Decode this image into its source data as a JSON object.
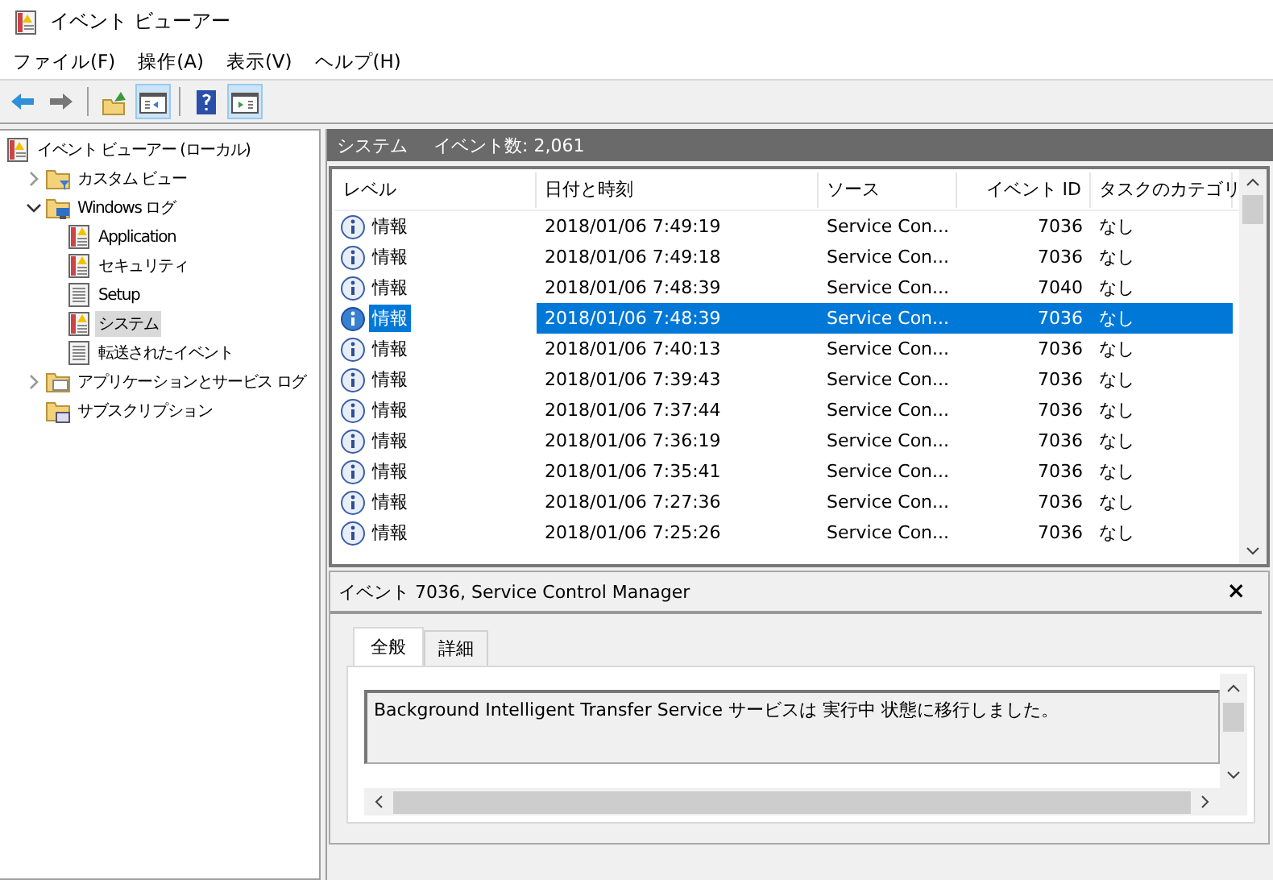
{
  "window": {
    "title": "イベント ビューアー"
  },
  "menu": [
    "ファイル(F)",
    "操作(A)",
    "表示(V)",
    "ヘルプ(H)"
  ],
  "toolbar": [
    {
      "kind": "back",
      "pressed": false
    },
    {
      "kind": "forward",
      "pressed": false
    },
    {
      "kind": "sep"
    },
    {
      "kind": "up",
      "pressed": false
    },
    {
      "kind": "tree-toggle",
      "pressed": true
    },
    {
      "kind": "sep"
    },
    {
      "kind": "help",
      "pressed": false
    },
    {
      "kind": "action-toggle",
      "pressed": true
    }
  ],
  "tree": [
    {
      "label": "イベント ビューアー (ローカル)",
      "kind": "viewer",
      "selected": false,
      "children": [
        {
          "label": "カスタム ビュー",
          "kind": "folder-filter",
          "expanded": false,
          "selected": false
        },
        {
          "label": "Windows ログ",
          "kind": "folder-computer",
          "expanded": true,
          "selected": false,
          "children": [
            {
              "label": "Application",
              "kind": "log-warn",
              "selected": false
            },
            {
              "label": "セキュリティ",
              "kind": "log-warn",
              "selected": false
            },
            {
              "label": "Setup",
              "kind": "log",
              "selected": false
            },
            {
              "label": "システム",
              "kind": "log-warn",
              "selected": true
            },
            {
              "label": "転送されたイベント",
              "kind": "log",
              "selected": false
            }
          ]
        },
        {
          "label": "アプリケーションとサービス ログ",
          "kind": "folder",
          "expanded": false,
          "selected": false
        },
        {
          "label": "サブスクリプション",
          "kind": "subscription",
          "selected": false
        }
      ]
    }
  ],
  "panel": {
    "title": "システム",
    "count": "イベント数: 2,061"
  },
  "table": {
    "columns": [
      "レベル",
      "日付と時刻",
      "ソース",
      "イベント ID",
      "タスクのカテゴリ"
    ],
    "rows": [
      {
        "level": "情報",
        "date": "2018/01/06 7:49:19",
        "source": "Service Con...",
        "id": "7036",
        "category": "なし",
        "selected": false
      },
      {
        "level": "情報",
        "date": "2018/01/06 7:49:18",
        "source": "Service Con...",
        "id": "7036",
        "category": "なし",
        "selected": false
      },
      {
        "level": "情報",
        "date": "2018/01/06 7:48:39",
        "source": "Service Con...",
        "id": "7040",
        "category": "なし",
        "selected": false
      },
      {
        "level": "情報",
        "date": "2018/01/06 7:48:39",
        "source": "Service Con...",
        "id": "7036",
        "category": "なし",
        "selected": true
      },
      {
        "level": "情報",
        "date": "2018/01/06 7:40:13",
        "source": "Service Con...",
        "id": "7036",
        "category": "なし",
        "selected": false
      },
      {
        "level": "情報",
        "date": "2018/01/06 7:39:43",
        "source": "Service Con...",
        "id": "7036",
        "category": "なし",
        "selected": false
      },
      {
        "level": "情報",
        "date": "2018/01/06 7:37:44",
        "source": "Service Con...",
        "id": "7036",
        "category": "なし",
        "selected": false
      },
      {
        "level": "情報",
        "date": "2018/01/06 7:36:19",
        "source": "Service Con...",
        "id": "7036",
        "category": "なし",
        "selected": false
      },
      {
        "level": "情報",
        "date": "2018/01/06 7:35:41",
        "source": "Service Con...",
        "id": "7036",
        "category": "なし",
        "selected": false
      },
      {
        "level": "情報",
        "date": "2018/01/06 7:27:36",
        "source": "Service Con...",
        "id": "7036",
        "category": "なし",
        "selected": false
      },
      {
        "level": "情報",
        "date": "2018/01/06 7:25:26",
        "source": "Service Con...",
        "id": "7036",
        "category": "なし",
        "selected": false
      }
    ]
  },
  "detail": {
    "title": "イベント 7036, Service Control Manager",
    "close": "×",
    "tabs": [
      {
        "label": "全般",
        "selected": true
      },
      {
        "label": "詳細",
        "selected": false
      }
    ],
    "message": "Background Intelligent Transfer Service サービスは 実行中 状態に移行しました。"
  }
}
